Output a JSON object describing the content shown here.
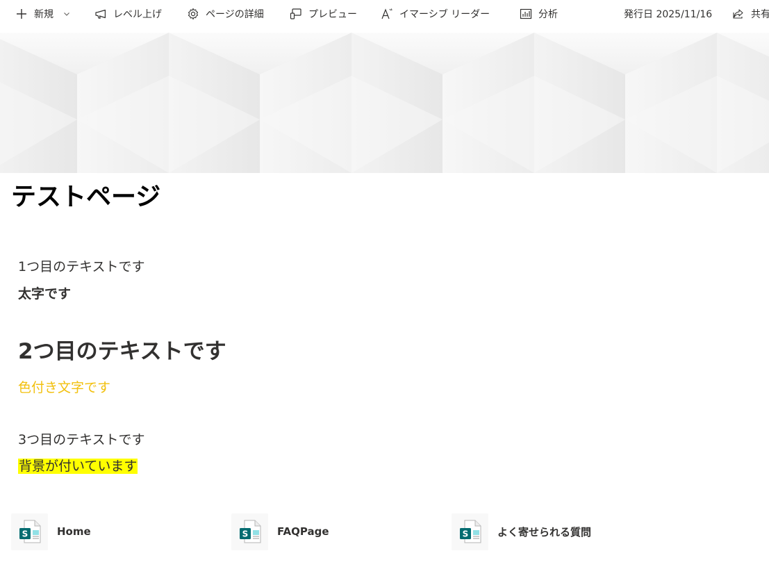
{
  "commandbar": {
    "new": "新規",
    "promote": "レベル上げ",
    "page_details": "ページの詳細",
    "preview": "プレビュー",
    "immersive_reader": "イマーシブ リーダー",
    "analytics": "分析",
    "published": "発行日 2025/11/16",
    "share": "共有"
  },
  "page": {
    "title": "テストページ"
  },
  "content": {
    "text1": "1つ目のテキストです",
    "bold": "太字です",
    "heading2": "2つ目のテキストです",
    "colored": "色付き文字です",
    "text3": "3つ目のテキストです",
    "highlighted": "背景が付いています"
  },
  "colors": {
    "colored_text": "#F2C00E",
    "highlight_bg": "#FFFF00",
    "sharepoint_teal": "#036C70"
  },
  "quicklinks": [
    {
      "label": "Home",
      "icon": "sharepoint-page-icon"
    },
    {
      "label": "FAQPage",
      "icon": "sharepoint-page-icon"
    },
    {
      "label": "よく寄せられる質問",
      "icon": "sharepoint-page-icon"
    }
  ]
}
